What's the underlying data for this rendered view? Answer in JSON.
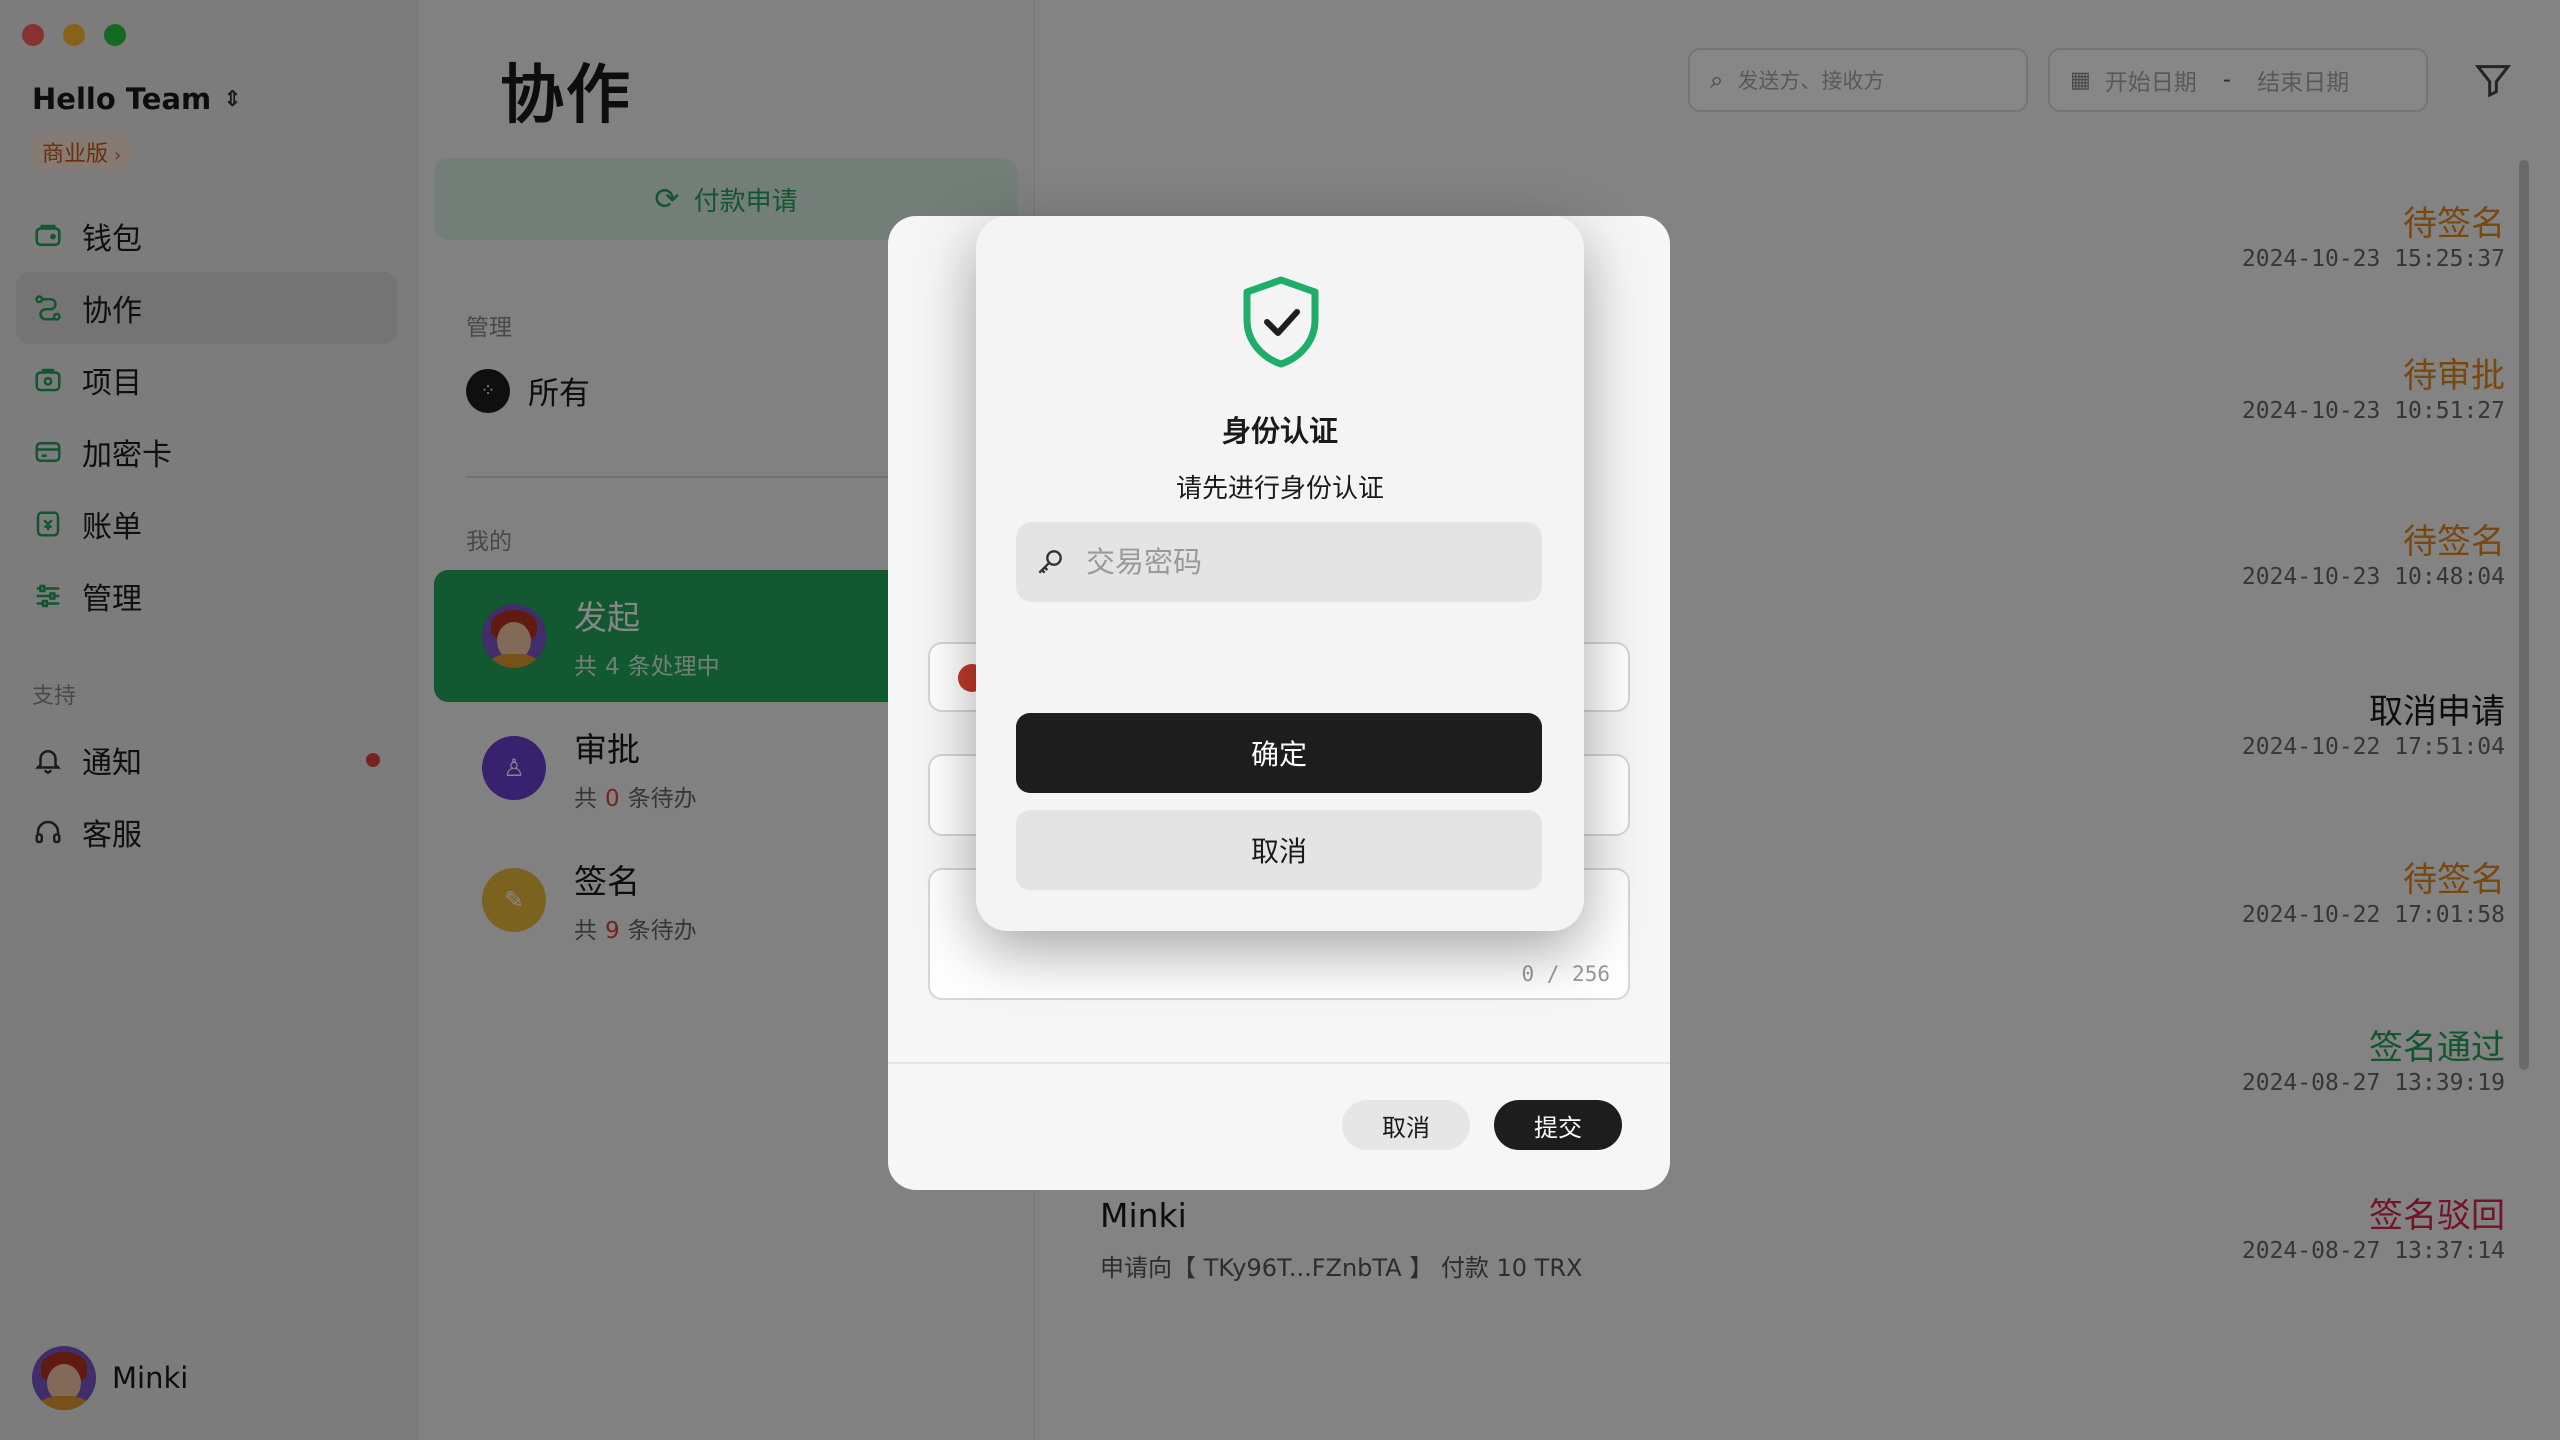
{
  "window": {
    "team_name": "Hello Team",
    "edition_badge": "商业版"
  },
  "sidebar": {
    "items": [
      {
        "label": "钱包",
        "icon": "wallet-icon"
      },
      {
        "label": "协作",
        "icon": "collab-icon"
      },
      {
        "label": "项目",
        "icon": "project-icon"
      },
      {
        "label": "加密卡",
        "icon": "card-icon"
      },
      {
        "label": "账单",
        "icon": "bill-icon"
      },
      {
        "label": "管理",
        "icon": "settings-sliders-icon"
      }
    ],
    "support_label": "支持",
    "support_items": [
      {
        "label": "通知",
        "icon": "bell-icon"
      },
      {
        "label": "客服",
        "icon": "headset-icon"
      }
    ],
    "user_name": "Minki"
  },
  "middle": {
    "title": "协作",
    "apply_button": "付款申请",
    "manage_label": "管理",
    "all_label": "所有",
    "mine_label": "我的",
    "tasks": [
      {
        "title": "发起",
        "prefix": "共",
        "count": "4",
        "suffix": "条处理中"
      },
      {
        "title": "审批",
        "prefix": "共",
        "count": "0",
        "suffix": "条待办"
      },
      {
        "title": "签名",
        "prefix": "共",
        "count": "9",
        "suffix": "条待办"
      }
    ]
  },
  "list": {
    "search_placeholder": "发送方、接收方",
    "date_start": "开始日期",
    "date_sep": "-",
    "date_end": "结束日期",
    "rows": [
      {
        "status": "待签名",
        "time": "2024-10-23 15:25:37",
        "color": "#e0891e"
      },
      {
        "status": "待审批",
        "time": "2024-10-23 10:51:27",
        "color": "#e0891e"
      },
      {
        "status": "待签名",
        "time": "2024-10-23 10:48:04",
        "color": "#e0891e"
      },
      {
        "status": "取消申请",
        "time": "2024-10-22 17:51:04",
        "color": "#1a1a1a"
      },
      {
        "status": "待签名",
        "time": "2024-10-22 17:01:58",
        "color": "#e0891e"
      },
      {
        "status": "签名通过",
        "time": "2024-08-27 13:39:19",
        "color": "#23a05a"
      },
      {
        "status": "签名驳回",
        "time": "2024-08-27 13:37:14",
        "color": "#d6274f",
        "name": "Minki",
        "desc": "申请向【 TKy96T...FZnbTA 】 付款 10 TRX"
      }
    ]
  },
  "form_modal": {
    "counter": "0 / 256",
    "cancel": "取消",
    "submit": "提交"
  },
  "auth": {
    "title": "身份认证",
    "subtitle": "请先进行身份认证",
    "placeholder": "交易密码",
    "confirm": "确定",
    "cancel": "取消"
  },
  "colors": {
    "accent_green": "#22a75d",
    "pending_orange": "#e0891e",
    "rejected_red": "#d6274f"
  }
}
